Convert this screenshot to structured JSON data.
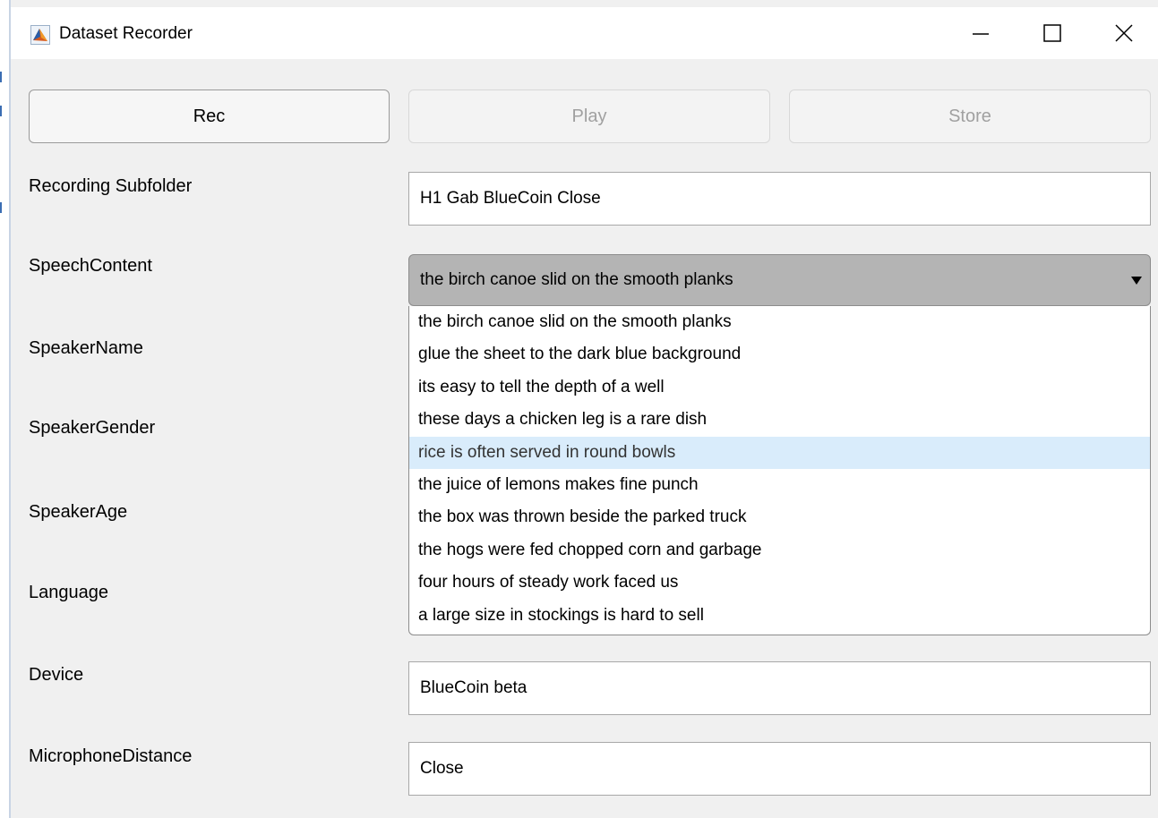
{
  "window": {
    "title": "Dataset Recorder",
    "icon": "matlab-membrane-icon",
    "controls": {
      "minimize": "minimize-icon",
      "maximize": "maximize-icon",
      "close": "close-icon"
    }
  },
  "toolbar": {
    "rec_label": "Rec",
    "play_label": "Play",
    "store_label": "Store"
  },
  "form": {
    "recording_subfolder": {
      "label": "Recording Subfolder",
      "value": "H1 Gab BlueCoin Close"
    },
    "speech_content": {
      "label": "SpeechContent",
      "value": "the birch canoe slid on the smooth planks"
    },
    "speaker_name": {
      "label": "SpeakerName"
    },
    "speaker_gender": {
      "label": "SpeakerGender"
    },
    "speaker_age": {
      "label": "SpeakerAge"
    },
    "language": {
      "label": "Language"
    },
    "device": {
      "label": "Device",
      "value": "BlueCoin beta"
    },
    "microphone_distance": {
      "label": "MicrophoneDistance",
      "value": "Close"
    }
  },
  "dropdown": {
    "options": [
      "the birch canoe slid on the smooth planks",
      "glue the sheet to the dark blue background",
      "its easy to tell the depth of a well",
      "these days a chicken leg is a rare dish",
      "rice is often served in round bowls",
      "the juice of lemons makes fine punch",
      "the box was thrown beside the parked truck",
      "the hogs were fed chopped corn and garbage",
      "four hours of steady work faced us",
      "a large size in stockings is hard to sell"
    ],
    "hovered_option": "rice is often served in round bowls"
  },
  "colors": {
    "window_bg": "#f0f0f0",
    "select_bg": "#b4b4b4",
    "hover_bg": "#d9ecfb",
    "disabled_text": "#a0a0a0"
  }
}
